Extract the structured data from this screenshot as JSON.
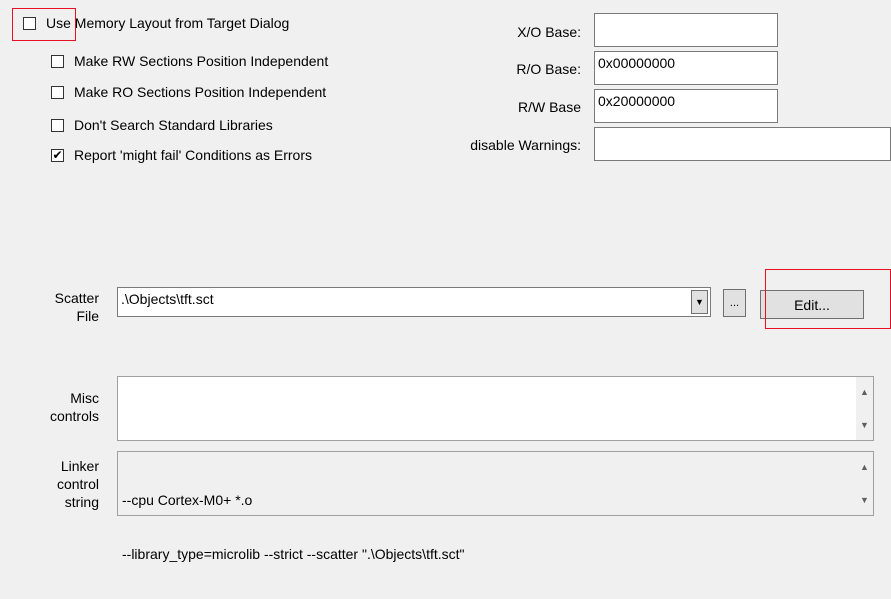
{
  "options": {
    "use_memory_layout": {
      "label": "Use Memory Layout from Target Dialog",
      "checked": false
    },
    "rw_position_independent": {
      "label": "Make RW Sections Position Independent",
      "checked": false
    },
    "ro_position_independent": {
      "label": "Make RO Sections Position Independent",
      "checked": false
    },
    "dont_search_std_libs": {
      "label": "Don't Search Standard Libraries",
      "checked": false
    },
    "report_might_fail": {
      "label": "Report 'might fail' Conditions as Errors",
      "checked": true
    }
  },
  "check_mark": "✔",
  "fields": {
    "xo_base": {
      "label": "X/O Base:",
      "value": ""
    },
    "ro_base": {
      "label": "R/O Base:",
      "value": "0x00000000"
    },
    "rw_base": {
      "label": "R/W Base",
      "value": "0x20000000"
    },
    "disable_warnings": {
      "label": "disable Warnings:",
      "value": ""
    }
  },
  "scatter": {
    "label_line1": "Scatter",
    "label_line2": "File",
    "value": ".\\Objects\\tft.sct",
    "browse_label": "...",
    "edit_label": "Edit..."
  },
  "misc": {
    "label_line1": "Misc",
    "label_line2": "controls",
    "value": ""
  },
  "linker": {
    "label_line1": "Linker",
    "label_line2": "control",
    "label_line3": "string",
    "line1": "--cpu Cortex-M0+ *.o",
    "line2": "--library_type=microlib --strict --scatter \".\\Objects\\tft.sct\""
  },
  "icons": {
    "dropdown": "▼",
    "scroll_up": "▲",
    "scroll_down": "▼"
  },
  "colors": {
    "highlight": "#e81123",
    "background": "#f0f0f0"
  }
}
